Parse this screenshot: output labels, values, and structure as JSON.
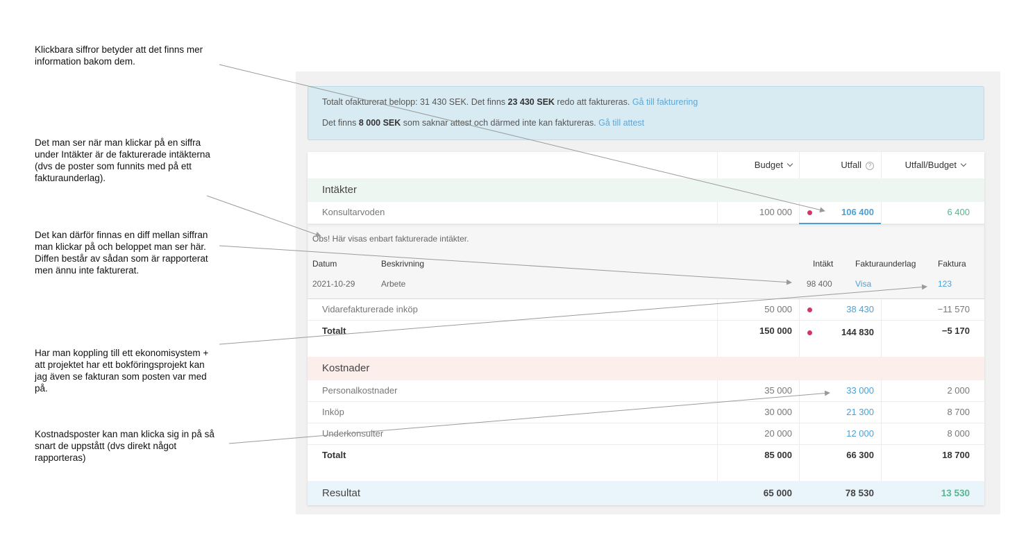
{
  "annotations": [
    "Klickbara siffror betyder att det finns mer information bakom dem.",
    "Det man ser när man klickar på en siffra under Intäkter är de fakturerade intäkterna (dvs de poster som funnits med på ett fakturaunderlag).",
    "Det kan därför finnas en diff mellan siffran man klickar på och beloppet man ser här. Diffen består av sådan som är rapporterat men ännu inte fakturerat.",
    "Har man koppling till ett ekonomisystem + att projektet har ett bokföringsprojekt kan jag även se fakturan som posten var med på.",
    "Kostnadsposter kan man klicka sig in på så snart de uppstått (dvs direkt något rapporteras)"
  ],
  "banner": {
    "line1_prefix": "Totalt ofakturerat belopp: 31 430 SEK. Det finns ",
    "line1_amount": "23 430 SEK",
    "line1_suffix": " redo att faktureras. ",
    "line1_link": "Gå till fakturering",
    "line2_prefix": "Det finns ",
    "line2_amount": "8 000 SEK",
    "line2_suffix": " som saknar attest och därmed inte kan faktureras. ",
    "line2_link": "Gå till attest"
  },
  "columns": {
    "budget": "Budget",
    "utfall": "Utfall",
    "utfall_budget": "Utfall/Budget",
    "help_glyph": "?"
  },
  "income": {
    "title": "Intäkter",
    "rows": [
      {
        "label": "Konsultarvoden",
        "budget": "100 000",
        "utfall": "106 400",
        "diff": "6 400"
      },
      {
        "label": "Vidarefakturerade inköp",
        "budget": "50 000",
        "utfall": "38 430",
        "diff": "−11 570"
      }
    ],
    "total": {
      "label": "Totalt",
      "budget": "150 000",
      "utfall": "144 830",
      "diff": "−5 170"
    }
  },
  "detail": {
    "note": "Obs! Här visas enbart fakturerade intäkter.",
    "headers": {
      "date": "Datum",
      "desc": "Beskrivning",
      "income": "Intäkt",
      "basis": "Fakturaunderlag",
      "invoice": "Faktura"
    },
    "row": {
      "date": "2021-10-29",
      "desc": "Arbete",
      "income": "98 400",
      "basis": "Visa",
      "invoice": "123"
    }
  },
  "costs": {
    "title": "Kostnader",
    "rows": [
      {
        "label": "Personalkostnader",
        "budget": "35 000",
        "utfall": "33 000",
        "diff": "2 000"
      },
      {
        "label": "Inköp",
        "budget": "30 000",
        "utfall": "21 300",
        "diff": "8 700"
      },
      {
        "label": "Underkonsulter",
        "budget": "20 000",
        "utfall": "12 000",
        "diff": "8 000"
      }
    ],
    "total": {
      "label": "Totalt",
      "budget": "85 000",
      "utfall": "66 300",
      "diff": "18 700"
    }
  },
  "result": {
    "label": "Resultat",
    "budget": "65 000",
    "utfall": "78 530",
    "diff": "13 530"
  },
  "colors": {
    "accent_blue": "#4aa0d6",
    "positive_green": "#55b68f",
    "alert_dot": "#d7336b",
    "banner_bg": "#d8ebf3",
    "income_bg": "#eef6f2",
    "cost_bg": "#fbeeeb",
    "result_bg": "#e9f4fb"
  }
}
